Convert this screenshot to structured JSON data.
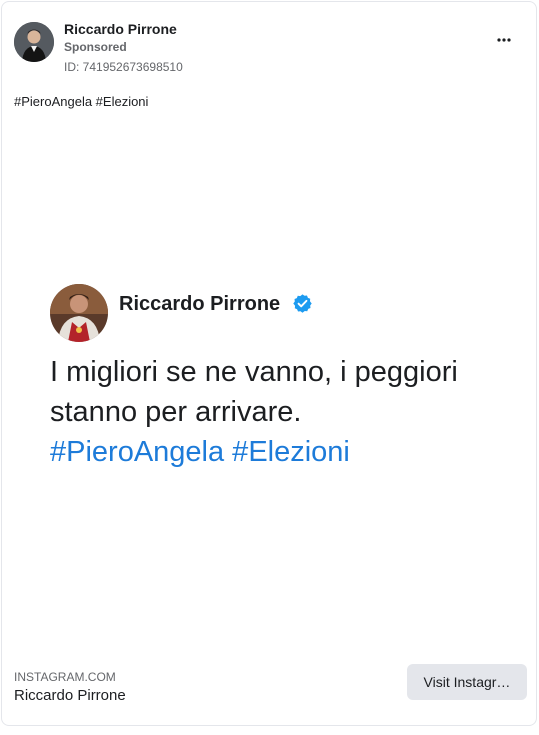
{
  "post": {
    "author_name": "Riccardo Pirrone",
    "sponsored_label": "Sponsored",
    "ad_id": "ID: 741952673698510",
    "more_icon": "more-horizontal-icon",
    "caption": "#PieroAngela #Elezioni"
  },
  "media": {
    "author_name": "Riccardo Pirrone",
    "verified_icon": "verified-badge-icon",
    "text_line_1": "I migliori se ne vanno, i peggiori",
    "text_line_2": "stanno per arrivare.",
    "hashtags": "#PieroAngela #Elezioni"
  },
  "link_preview": {
    "domain": "INSTAGRAM.COM",
    "title": "Riccardo Pirrone",
    "cta_label": "Visit Instagr…"
  },
  "colors": {
    "hashtag_blue": "#1d7bd9",
    "verified_blue": "#1d9bf0",
    "secondary_text": "#65676b",
    "button_bg": "#e4e6eb"
  }
}
